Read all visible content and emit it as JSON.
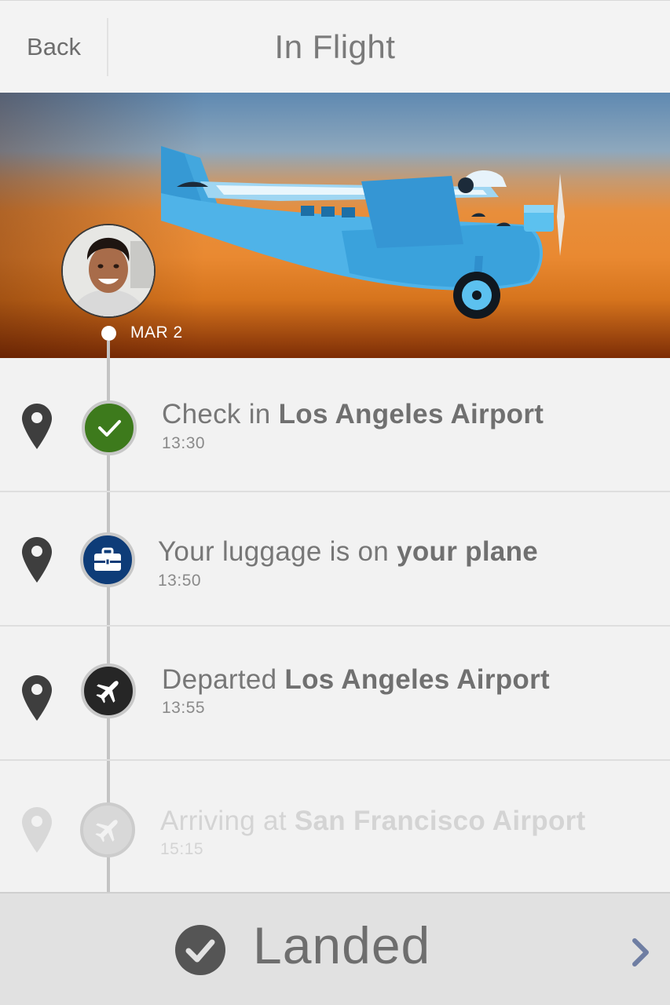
{
  "header": {
    "back_label": "Back",
    "title": "In Flight"
  },
  "hero": {
    "date": "MAR 2"
  },
  "timeline": [
    {
      "prefix": "Check in ",
      "place": "Los Angeles Airport",
      "time": "13:30",
      "icon": "checkmark-icon",
      "color": "#3d7a1c",
      "state": "done"
    },
    {
      "prefix": "Your luggage is on ",
      "place": "your plane",
      "time": "13:50",
      "icon": "briefcase-icon",
      "color": "#0e3c78",
      "state": "done"
    },
    {
      "prefix": "Departed ",
      "place": "Los Angeles Airport",
      "time": "13:55",
      "icon": "airplane-icon",
      "color": "#262626",
      "state": "done"
    },
    {
      "prefix": "Arriving at ",
      "place": "San Francisco Airport",
      "time": "15:15",
      "icon": "airplane-icon",
      "color": "#d8d8d8",
      "state": "upcoming"
    }
  ],
  "footer": {
    "status": "Landed",
    "status_icon": "check-circle-icon",
    "chevron_icon": "chevron-right-icon",
    "chevron_color": "#6f7ea3"
  }
}
